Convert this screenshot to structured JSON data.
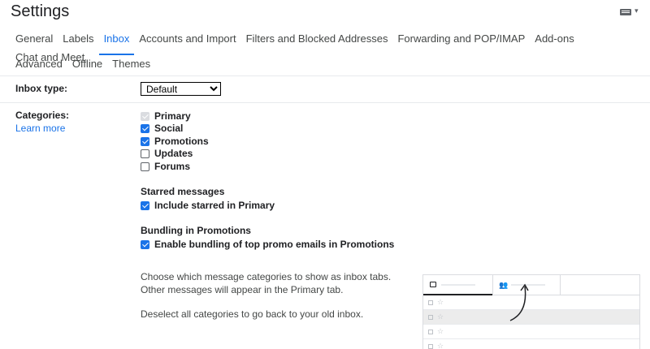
{
  "header": {
    "title": "Settings",
    "keyboard_icon": "keyboard-icon",
    "caret_glyph": "▾"
  },
  "tabs": {
    "row1": [
      "General",
      "Labels",
      "Inbox",
      "Accounts and Import",
      "Filters and Blocked Addresses",
      "Forwarding and POP/IMAP",
      "Add-ons",
      "Chat and Meet"
    ],
    "row2": [
      "Advanced",
      "Offline",
      "Themes"
    ],
    "active": "Inbox"
  },
  "inbox_type": {
    "label": "Inbox type:",
    "selected": "Default"
  },
  "categories": {
    "label": "Categories:",
    "learn_more": "Learn more",
    "items": [
      {
        "label": "Primary",
        "state": "disabled-checked"
      },
      {
        "label": "Social",
        "state": "checked"
      },
      {
        "label": "Promotions",
        "state": "checked"
      },
      {
        "label": "Updates",
        "state": "unchecked"
      },
      {
        "label": "Forums",
        "state": "unchecked"
      }
    ]
  },
  "starred": {
    "title": "Starred messages",
    "option": "Include starred in Primary",
    "checked": true
  },
  "bundling": {
    "title": "Bundling in Promotions",
    "option": "Enable bundling of top promo emails in Promotions",
    "checked": true
  },
  "description": {
    "para1": "Choose which message categories to show as inbox tabs. Other messages will appear in the Primary tab.",
    "para2": "Deselect all categories to go back to your old inbox."
  },
  "preview": {
    "star_glyph": "☆",
    "people_glyph": "👥",
    "rows": 4
  },
  "colors": {
    "accent": "#1a73e8",
    "text": "#202124",
    "muted": "#444746",
    "divider": "#e8eaed"
  }
}
